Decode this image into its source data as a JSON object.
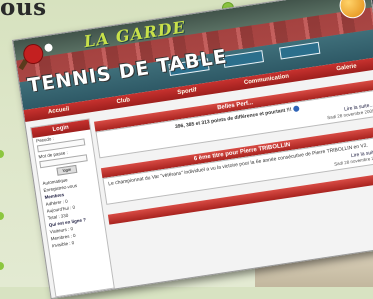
{
  "magazine": {
    "heading_fragment": "ous"
  },
  "site": {
    "brand_top": "LA GARDE",
    "brand_main": "TENNIS DE TABLE",
    "nav": [
      "Accueil",
      "Club",
      "Sportif",
      "Communication",
      "Galerie"
    ],
    "sidebar": {
      "title": "Login",
      "pseudo_label": "Pseudo :",
      "password_label": "Mot de passe :",
      "login_button": "login",
      "remember_label": "Automatique",
      "register_text": "Enregistrez-vous",
      "members_title": "Membres",
      "members_lines": [
        "Adhérer : 0",
        "Aujourd'hui : 0",
        "Total : 330"
      ],
      "online_title": "Qui est en ligne ?",
      "online_lines": [
        "Visiteurs : 0",
        "Membres : 0",
        "Invisible : 0"
      ]
    },
    "news": [
      {
        "title": "Belles Perf...",
        "body": "396, 385 et 313 points de différence et pourtant !!!",
        "more": "Lire la suite...",
        "meta": "Sadi 28 novembre 2009"
      },
      {
        "title": "6 ème titre pour Pierre TRIBOLLIN",
        "body": "Le championnat du Var \"vétérans\" individuel a vu la victoire pour la 6e année consécutive de Pierre TRIBOLLIN en V2.",
        "more": "Lire la suite...",
        "meta": "Sadi 28 novembre 2009"
      }
    ]
  }
}
